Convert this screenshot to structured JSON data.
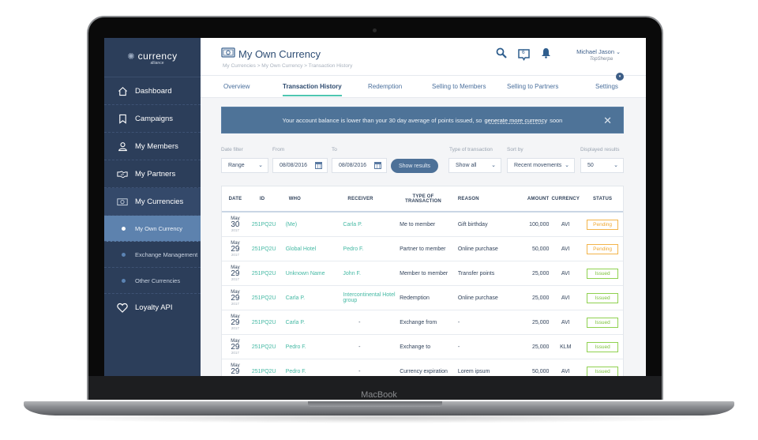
{
  "device": {
    "brand_label": "MacBook"
  },
  "sidebar": {
    "logo": {
      "name": "currency",
      "sub": "alliance"
    },
    "items": [
      {
        "label": "Dashboard",
        "icon": "home-icon"
      },
      {
        "label": "Campaigns",
        "icon": "bookmark-icon"
      },
      {
        "label": "My Members",
        "icon": "user-icon"
      },
      {
        "label": "My Partners",
        "icon": "handshake-icon"
      },
      {
        "label": "My Currencies",
        "icon": "banknote-icon"
      },
      {
        "label": "Loyalty API",
        "icon": "heart-icon"
      }
    ],
    "sub_items": [
      {
        "label": "My Own Currency",
        "active": true
      },
      {
        "label": "Exchange Management",
        "active": false
      },
      {
        "label": "Other Currencies",
        "active": false
      }
    ]
  },
  "header": {
    "title": "My Own Currency",
    "breadcrumb": "My Currencies > My Own Currency > Transaction History",
    "messages_count": "6",
    "user_name": "Michael Jason",
    "user_company": "TopSherpa"
  },
  "tabs": [
    {
      "label": "Overview",
      "active": false
    },
    {
      "label": "Transaction History",
      "active": true
    },
    {
      "label": "Redemption",
      "active": false
    },
    {
      "label": "Selling to Members",
      "active": false
    },
    {
      "label": "Selling to Partners",
      "active": false
    },
    {
      "label": "Settings",
      "active": false
    }
  ],
  "alert": {
    "text_before": "Your account balance is lower than your 30 day average of points issued, so",
    "link": "generate more currency",
    "text_after": "soon"
  },
  "filters": {
    "date_filter": {
      "label": "Date filter",
      "value": "Range"
    },
    "from": {
      "label": "From",
      "value": "08/08/2016"
    },
    "to": {
      "label": "To",
      "value": "08/08/2016"
    },
    "show_results": "Show results",
    "type": {
      "label": "Type of transaction",
      "value": "Show all"
    },
    "sort_by": {
      "label": "Sort by",
      "value": "Recent movements"
    },
    "displayed": {
      "label": "Displayed results",
      "value": "50"
    }
  },
  "table": {
    "columns": [
      "DATE",
      "ID",
      "WHO",
      "RECEIVER",
      "TYPE OF TRANSACTION",
      "REASON",
      "AMOUNT",
      "CURRENCY",
      "STATUS"
    ],
    "rows": [
      {
        "month": "May",
        "day": "30",
        "year": "2017",
        "id": "251PQ2U",
        "who": "(Me)",
        "receiver": "Carla P.",
        "type": "Me to member",
        "reason": "Gift birthday",
        "amount": "100,000",
        "currency": "AVI",
        "status": "Pending"
      },
      {
        "month": "May",
        "day": "29",
        "year": "2017",
        "id": "251PQ2U",
        "who": "Global Hotel",
        "receiver": "Pedro F.",
        "type": "Partner to member",
        "reason": "Online purchase",
        "amount": "50,000",
        "currency": "AVI",
        "status": "Pending"
      },
      {
        "month": "May",
        "day": "29",
        "year": "2017",
        "id": "251PQ2U",
        "who": "Unknown Name",
        "receiver": "John F.",
        "type": "Member to member",
        "reason": "Transfer points",
        "amount": "25,000",
        "currency": "AVI",
        "status": "Issued"
      },
      {
        "month": "May",
        "day": "29",
        "year": "2017",
        "id": "251PQ2U",
        "who": "Carla P.",
        "receiver": "Intercontinental Hotel group",
        "type": "Redemption",
        "reason": "Online purchase",
        "amount": "25,000",
        "currency": "AVI",
        "status": "Issued"
      },
      {
        "month": "May",
        "day": "29",
        "year": "2017",
        "id": "251PQ2U",
        "who": "Carla P.",
        "receiver": "-",
        "type": "Exchange from",
        "reason": "-",
        "amount": "25,000",
        "currency": "AVI",
        "status": "Issued"
      },
      {
        "month": "May",
        "day": "29",
        "year": "2017",
        "id": "251PQ2U",
        "who": "Pedro F.",
        "receiver": "-",
        "type": "Exchange to",
        "reason": "-",
        "amount": "25,000",
        "currency": "KLM",
        "status": "Issued"
      },
      {
        "month": "May",
        "day": "29",
        "year": "2017",
        "id": "251PQ2U",
        "who": "Pedro F.",
        "receiver": "-",
        "type": "Currency expiration",
        "reason": "Lorem ipsum",
        "amount": "50,000",
        "currency": "AVI",
        "status": "Issued"
      }
    ]
  }
}
